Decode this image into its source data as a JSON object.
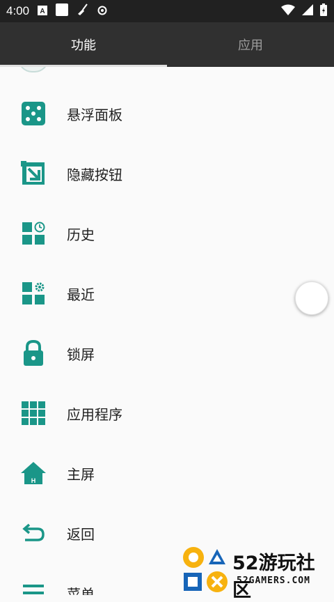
{
  "status_bar": {
    "time": "4:00"
  },
  "tabs": [
    {
      "label": "功能"
    },
    {
      "label": "应用"
    }
  ],
  "items": [
    {
      "label": "悬浮面板",
      "icon": "dice-icon"
    },
    {
      "label": "隐藏按钮",
      "icon": "arrow-in-box-icon"
    },
    {
      "label": "历史",
      "icon": "grid-clock-icon"
    },
    {
      "label": "最近",
      "icon": "grid-gear-icon"
    },
    {
      "label": "锁屏",
      "icon": "lock-icon"
    },
    {
      "label": "应用程序",
      "icon": "apps-grid-icon"
    },
    {
      "label": "主屏",
      "icon": "home-icon"
    },
    {
      "label": "返回",
      "icon": "back-icon"
    },
    {
      "label": "菜单",
      "icon": "menu-icon"
    }
  ],
  "watermark": {
    "title": "52游玩社区",
    "subtitle": "52GAMERS.COM"
  },
  "colors": {
    "accent": "#1a9688",
    "tab_bar": "#303030",
    "status_bar": "#212121"
  }
}
